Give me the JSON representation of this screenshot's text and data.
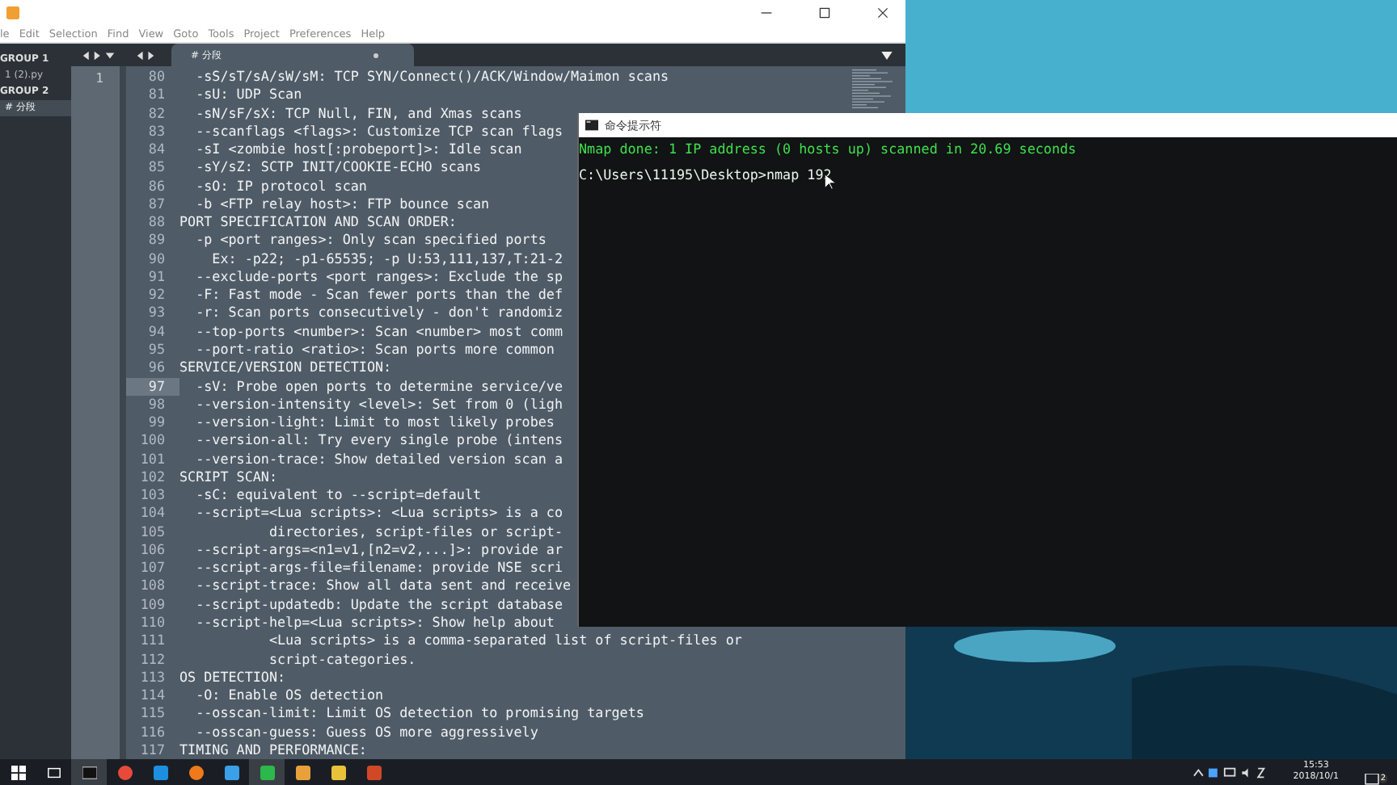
{
  "editor": {
    "menu": [
      "le",
      "Edit",
      "Selection",
      "Find",
      "View",
      "Goto",
      "Tools",
      "Project",
      "Preferences",
      "Help"
    ],
    "sidebar": [
      {
        "label": "GROUP 1",
        "files": [
          {
            "label": "1 (2).py",
            "selected": false
          }
        ]
      },
      {
        "label": "GROUP 2",
        "files": [
          {
            "label": "# 分段",
            "selected": true
          }
        ]
      }
    ],
    "tab": {
      "label": "# 分段"
    },
    "left_pane_line": "1",
    "lines": [
      {
        "number": "80",
        "text": "  -sS/sT/sA/sW/sM: TCP SYN/Connect()/ACK/Window/Maimon scans",
        "current": false
      },
      {
        "number": "81",
        "text": "  -sU: UDP Scan",
        "current": false
      },
      {
        "number": "82",
        "text": "  -sN/sF/sX: TCP Null, FIN, and Xmas scans",
        "current": false
      },
      {
        "number": "83",
        "text": "  --scanflags <flags>: Customize TCP scan flags",
        "current": false
      },
      {
        "number": "84",
        "text": "  -sI <zombie host[:probeport]>: Idle scan",
        "current": false
      },
      {
        "number": "85",
        "text": "  -sY/sZ: SCTP INIT/COOKIE-ECHO scans",
        "current": false
      },
      {
        "number": "86",
        "text": "  -sO: IP protocol scan",
        "current": false
      },
      {
        "number": "87",
        "text": "  -b <FTP relay host>: FTP bounce scan",
        "current": false
      },
      {
        "number": "88",
        "text": "PORT SPECIFICATION AND SCAN ORDER:",
        "current": false
      },
      {
        "number": "89",
        "text": "  -p <port ranges>: Only scan specified ports",
        "current": false
      },
      {
        "number": "90",
        "text": "    Ex: -p22; -p1-65535; -p U:53,111,137,T:21-2",
        "current": false
      },
      {
        "number": "91",
        "text": "  --exclude-ports <port ranges>: Exclude the sp",
        "current": false
      },
      {
        "number": "92",
        "text": "  -F: Fast mode - Scan fewer ports than the def",
        "current": false
      },
      {
        "number": "93",
        "text": "  -r: Scan ports consecutively - don't randomiz",
        "current": false
      },
      {
        "number": "94",
        "text": "  --top-ports <number>: Scan <number> most comm",
        "current": false
      },
      {
        "number": "95",
        "text": "  --port-ratio <ratio>: Scan ports more common",
        "current": false
      },
      {
        "number": "96",
        "text": "SERVICE/VERSION DETECTION:",
        "current": false
      },
      {
        "number": "97",
        "text": "  -sV: Probe open ports to determine service/ve",
        "current": true
      },
      {
        "number": "98",
        "text": "  --version-intensity <level>: Set from 0 (ligh",
        "current": false
      },
      {
        "number": "99",
        "text": "  --version-light: Limit to most likely probes",
        "current": false
      },
      {
        "number": "100",
        "text": "  --version-all: Try every single probe (intens",
        "current": false
      },
      {
        "number": "101",
        "text": "  --version-trace: Show detailed version scan a",
        "current": false
      },
      {
        "number": "102",
        "text": "SCRIPT SCAN:",
        "current": false
      },
      {
        "number": "103",
        "text": "  -sC: equivalent to --script=default",
        "current": false
      },
      {
        "number": "104",
        "text": "  --script=<Lua scripts>: <Lua scripts> is a co",
        "current": false
      },
      {
        "number": "105",
        "text": "           directories, script-files or script-",
        "current": false
      },
      {
        "number": "106",
        "text": "  --script-args=<n1=v1,[n2=v2,...]>: provide ar",
        "current": false
      },
      {
        "number": "107",
        "text": "  --script-args-file=filename: provide NSE scri",
        "current": false
      },
      {
        "number": "108",
        "text": "  --script-trace: Show all data sent and receive",
        "current": false
      },
      {
        "number": "109",
        "text": "  --script-updatedb: Update the script database",
        "current": false
      },
      {
        "number": "110",
        "text": "  --script-help=<Lua scripts>: Show help about",
        "current": false
      },
      {
        "number": "111",
        "text": "           <Lua scripts> is a comma-separated list of script-files or",
        "current": false
      },
      {
        "number": "112",
        "text": "           script-categories.",
        "current": false
      },
      {
        "number": "113",
        "text": "OS DETECTION:",
        "current": false
      },
      {
        "number": "114",
        "text": "  -O: Enable OS detection",
        "current": false
      },
      {
        "number": "115",
        "text": "  --osscan-limit: Limit OS detection to promising targets",
        "current": false
      },
      {
        "number": "116",
        "text": "  --osscan-guess: Guess OS more aggressively",
        "current": false
      },
      {
        "number": "117",
        "text": "TIMING AND PERFORMANCE:",
        "current": false
      }
    ]
  },
  "terminal": {
    "title": "命令提示符",
    "lines": [
      {
        "text": "Nmap done: 1 IP address (0 hosts up) scanned in 20.69 seconds",
        "kind": "output"
      },
      {
        "text": "C:\\Users\\11195\\Desktop>nmap 192",
        "kind": "prompt"
      }
    ]
  },
  "taskbar": {
    "apps": [
      {
        "kind": "start",
        "active": false
      },
      {
        "kind": "taskview",
        "active": false
      },
      {
        "kind": "terminal",
        "active": true
      },
      {
        "kind": "chrome",
        "active": false
      },
      {
        "kind": "star",
        "active": false
      },
      {
        "kind": "firefox",
        "active": false
      },
      {
        "kind": "blue",
        "active": false
      },
      {
        "kind": "green",
        "active": true
      },
      {
        "kind": "sublime",
        "active": false
      },
      {
        "kind": "yellow",
        "active": false
      },
      {
        "kind": "slides",
        "active": false
      }
    ],
    "time": "15:53",
    "date": "2018/10/1",
    "notifications": "2"
  }
}
